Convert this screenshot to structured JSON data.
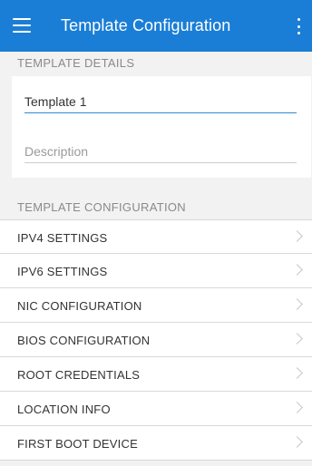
{
  "header": {
    "title": "Template Configuration",
    "menu_icon": "hamburger-menu-icon",
    "overflow_icon": "more-vertical-icon",
    "color": "#1a7ed6"
  },
  "details": {
    "heading": "TEMPLATE DETAILS",
    "name_value": "Template 1",
    "description_placeholder": "Description"
  },
  "configuration": {
    "heading": "TEMPLATE CONFIGURATION",
    "items": [
      {
        "label": "IPV4 SETTINGS"
      },
      {
        "label": "IPV6 SETTINGS"
      },
      {
        "label": "NIC CONFIGURATION"
      },
      {
        "label": "BIOS CONFIGURATION"
      },
      {
        "label": "ROOT CREDENTIALS"
      },
      {
        "label": "LOCATION INFO"
      },
      {
        "label": "FIRST BOOT DEVICE"
      }
    ],
    "chevron_icon": "chevron-right-icon"
  }
}
